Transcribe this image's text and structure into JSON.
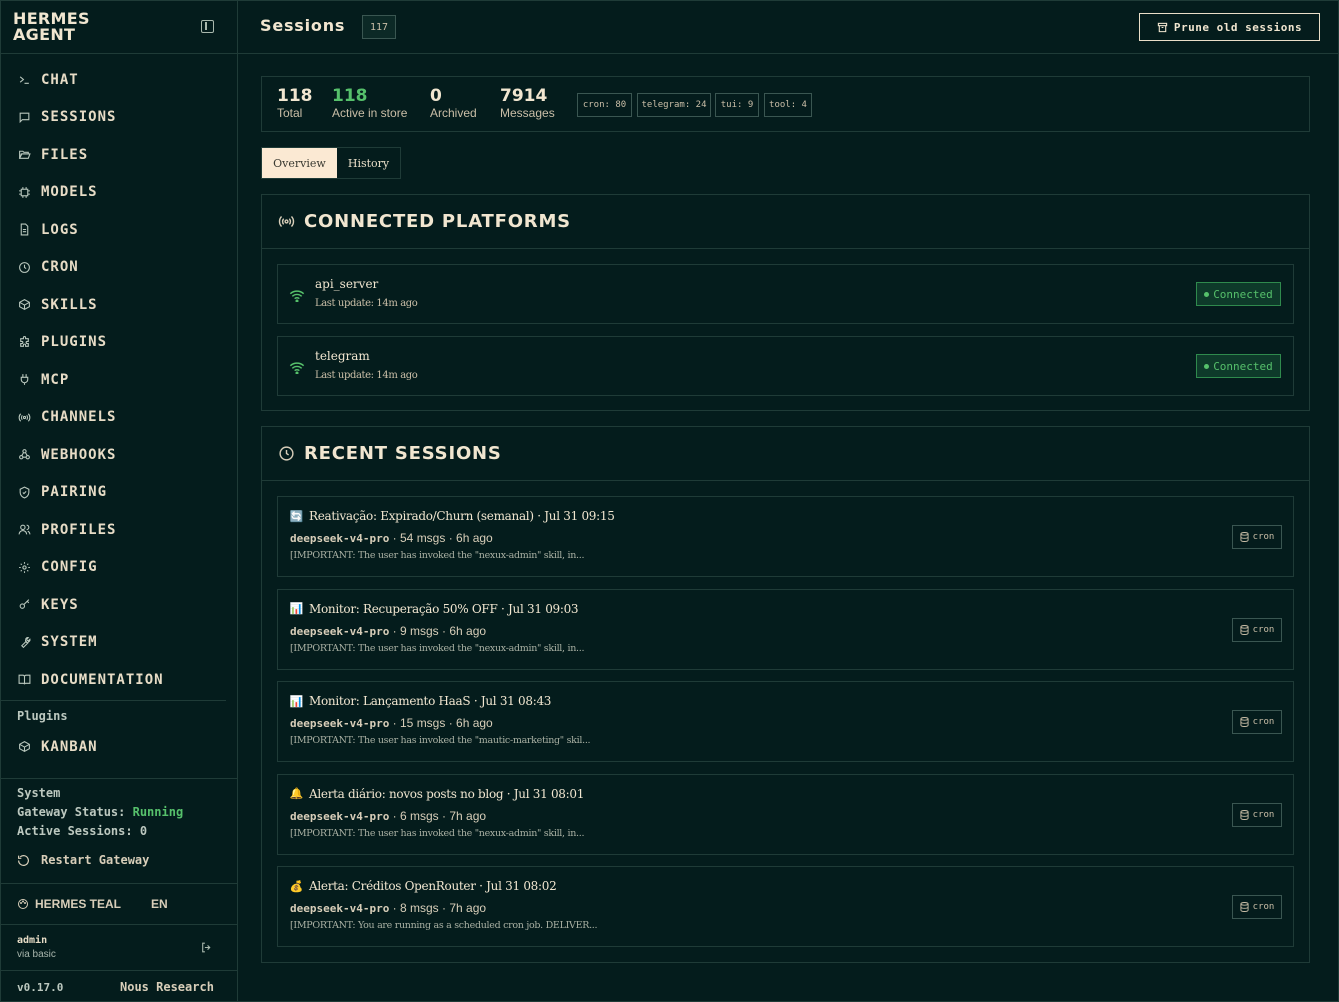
{
  "brand": {
    "line1": "HERMES",
    "line2": "AGENT"
  },
  "nav": [
    {
      "label": "CHAT",
      "icon": "terminal-icon"
    },
    {
      "label": "SESSIONS",
      "icon": "message-square-icon"
    },
    {
      "label": "FILES",
      "icon": "folder-open-icon"
    },
    {
      "label": "MODELS",
      "icon": "cpu-icon"
    },
    {
      "label": "LOGS",
      "icon": "file-text-icon"
    },
    {
      "label": "CRON",
      "icon": "clock-icon"
    },
    {
      "label": "SKILLS",
      "icon": "package-icon"
    },
    {
      "label": "PLUGINS",
      "icon": "puzzle-icon"
    },
    {
      "label": "MCP",
      "icon": "plug-icon"
    },
    {
      "label": "CHANNELS",
      "icon": "radio-icon"
    },
    {
      "label": "WEBHOOKS",
      "icon": "webhook-icon"
    },
    {
      "label": "PAIRING",
      "icon": "shield-check-icon"
    },
    {
      "label": "PROFILES",
      "icon": "users-icon"
    },
    {
      "label": "CONFIG",
      "icon": "settings-icon"
    },
    {
      "label": "KEYS",
      "icon": "key-icon"
    },
    {
      "label": "SYSTEM",
      "icon": "wrench-icon"
    },
    {
      "label": "DOCUMENTATION",
      "icon": "book-open-icon"
    }
  ],
  "plugins_heading": "Plugins",
  "kanban_label": "KANBAN",
  "system": {
    "heading": "System",
    "gateway_label": "Gateway Status:",
    "gateway_value": "Running",
    "active_label": "Active Sessions:",
    "active_value": "0",
    "restart_label": "Restart Gateway"
  },
  "theme": {
    "label": "HERMES TEAL",
    "lang": "EN"
  },
  "user": {
    "name": "admin",
    "via": "via basic"
  },
  "version": "v0.17.0",
  "org": "Nous Research",
  "header": {
    "title": "Sessions",
    "count": "117",
    "prune_label": "Prune old sessions"
  },
  "stats": [
    {
      "value": "118",
      "label": "Total"
    },
    {
      "value": "118",
      "label": "Active in store"
    },
    {
      "value": "0",
      "label": "Archived"
    },
    {
      "value": "7914",
      "label": "Messages"
    }
  ],
  "chips": [
    "cron: 80",
    "telegram: 24",
    "tui: 9",
    "tool: 4"
  ],
  "tabs": [
    "Overview",
    "History"
  ],
  "platforms_title": "CONNECTED PLATFORMS",
  "platforms": [
    {
      "name": "api_server",
      "updated": "Last update: 14m ago",
      "status": "Connected"
    },
    {
      "name": "telegram",
      "updated": "Last update: 14m ago",
      "status": "Connected"
    }
  ],
  "recent_title": "RECENT SESSIONS",
  "sessions": [
    {
      "emoji": "🔄",
      "title": "Reativação: Expirado/Churn (semanal) · Jul 31 09:15",
      "model": "deepseek-v4-pro",
      "meta": " · 54 msgs · 6h ago",
      "snippet": "[IMPORTANT: The user has invoked the \"nexux-admin\" skill, in...",
      "source": "cron"
    },
    {
      "emoji": "📊",
      "title": "Monitor: Recuperação 50% OFF · Jul 31 09:03",
      "model": "deepseek-v4-pro",
      "meta": " · 9 msgs · 6h ago",
      "snippet": "[IMPORTANT: The user has invoked the \"nexux-admin\" skill, in...",
      "source": "cron"
    },
    {
      "emoji": "📊",
      "title": "Monitor: Lançamento HaaS · Jul 31 08:43",
      "model": "deepseek-v4-pro",
      "meta": " · 15 msgs · 6h ago",
      "snippet": "[IMPORTANT: The user has invoked the \"mautic-marketing\" skil...",
      "source": "cron"
    },
    {
      "emoji": "🔔",
      "title": "Alerta diário: novos posts no blog · Jul 31 08:01",
      "model": "deepseek-v4-pro",
      "meta": " · 6 msgs · 7h ago",
      "snippet": "[IMPORTANT: The user has invoked the \"nexux-admin\" skill, in...",
      "source": "cron"
    },
    {
      "emoji": "💰",
      "title": "Alerta: Créditos OpenRouter · Jul 31 08:02",
      "model": "deepseek-v4-pro",
      "meta": " · 8 msgs · 7h ago",
      "snippet": "[IMPORTANT: You are running as a scheduled cron job. DELIVER...",
      "source": "cron"
    }
  ]
}
